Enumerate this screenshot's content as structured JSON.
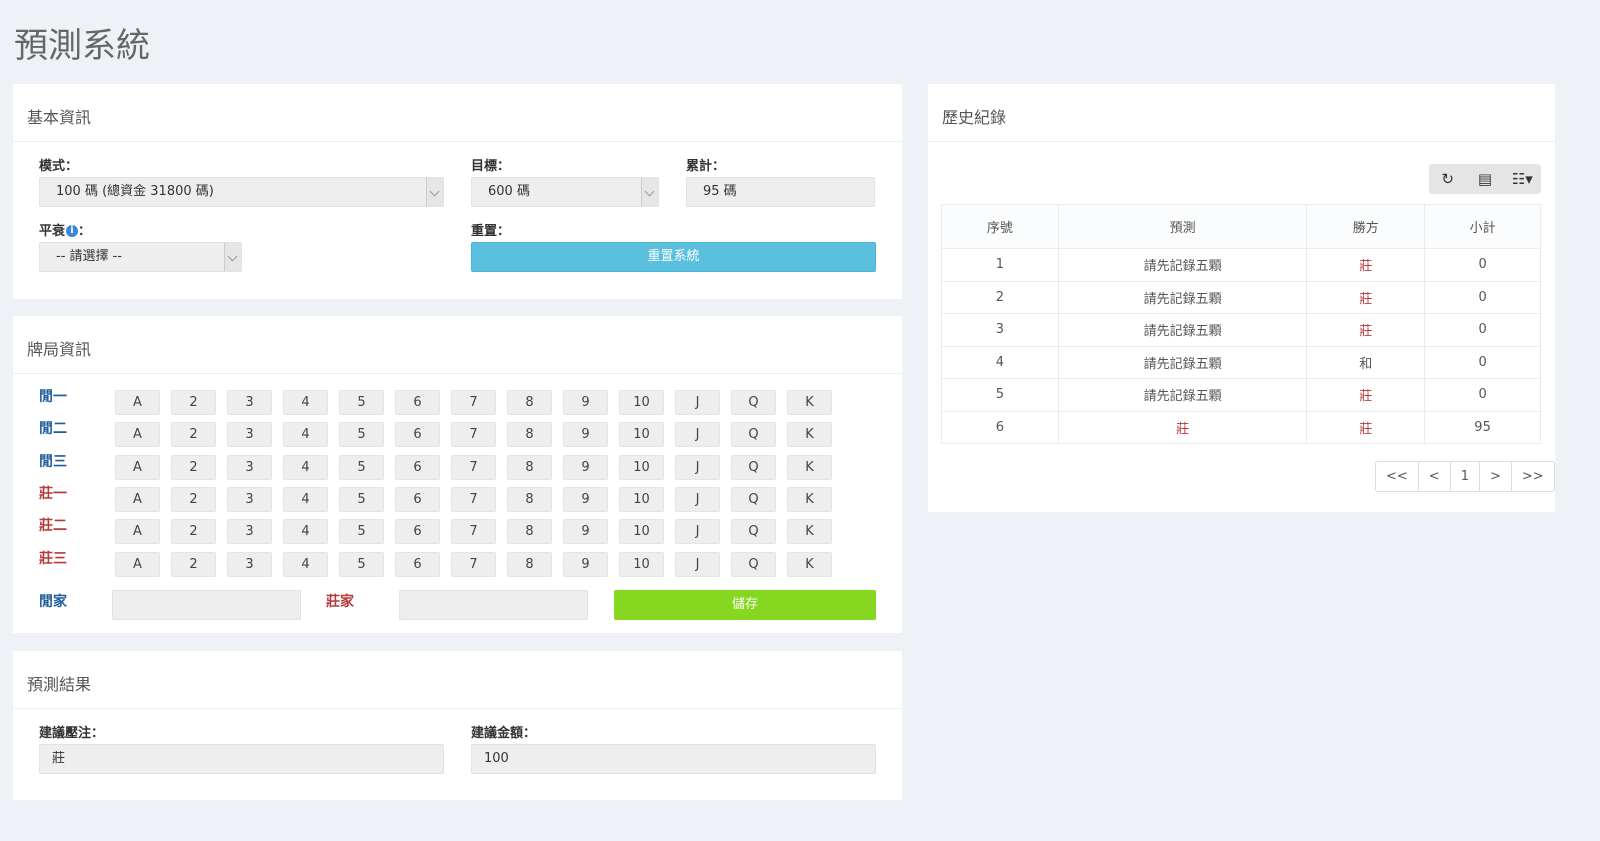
{
  "page_title": "預測系統",
  "basic": {
    "title": "基本資訊",
    "mode_label": "模式：",
    "mode_value": "100 碼 (總資金 31800 碼)",
    "target_label": "目標：",
    "target_value": "600 碼",
    "total_label": "累計：",
    "total_value": "95 碼",
    "tie_label": "平衰",
    "tie_colon": "：",
    "tie_value": "-- 請選擇 --",
    "reset_label": "重置：",
    "reset_button": "重置系統"
  },
  "cards": {
    "title": "牌局資訊",
    "ranks": [
      "A",
      "2",
      "3",
      "4",
      "5",
      "6",
      "7",
      "8",
      "9",
      "10",
      "J",
      "Q",
      "K"
    ],
    "rows": [
      {
        "label": "閒一",
        "side": "player"
      },
      {
        "label": "閒二",
        "side": "player"
      },
      {
        "label": "閒三",
        "side": "player"
      },
      {
        "label": "莊一",
        "side": "banker"
      },
      {
        "label": "莊二",
        "side": "banker"
      },
      {
        "label": "莊三",
        "side": "banker"
      }
    ],
    "player_label": "閒家",
    "banker_label": "莊家",
    "player_value": "",
    "banker_value": "",
    "save_button": "儲存"
  },
  "result": {
    "title": "預測結果",
    "bet_label": "建議壓注：",
    "bet_value": "莊",
    "amount_label": "建議金額：",
    "amount_value": "100"
  },
  "history": {
    "title": "歷史紀錄",
    "toolbar_icons": [
      "refresh-icon",
      "list-icon",
      "columns-icon"
    ],
    "columns": [
      "序號",
      "預測",
      "勝方",
      "小計"
    ],
    "rows": [
      {
        "no": "1",
        "predict": "請先記錄五顆",
        "winner": "莊",
        "subtotal": "0"
      },
      {
        "no": "2",
        "predict": "請先記錄五顆",
        "winner": "莊",
        "subtotal": "0"
      },
      {
        "no": "3",
        "predict": "請先記錄五顆",
        "winner": "莊",
        "subtotal": "0"
      },
      {
        "no": "4",
        "predict": "請先記錄五顆",
        "winner": "和",
        "subtotal": "0"
      },
      {
        "no": "5",
        "predict": "請先記錄五顆",
        "winner": "莊",
        "subtotal": "0"
      },
      {
        "no": "6",
        "predict": "莊",
        "winner": "莊",
        "subtotal": "95"
      }
    ],
    "pager": [
      "<<",
      "<",
      "1",
      ">",
      ">>"
    ]
  },
  "colors": {
    "player": "#1f5d9c",
    "banker": "#b73a3a",
    "reset": "#5bc0de",
    "save": "#85d81f"
  }
}
